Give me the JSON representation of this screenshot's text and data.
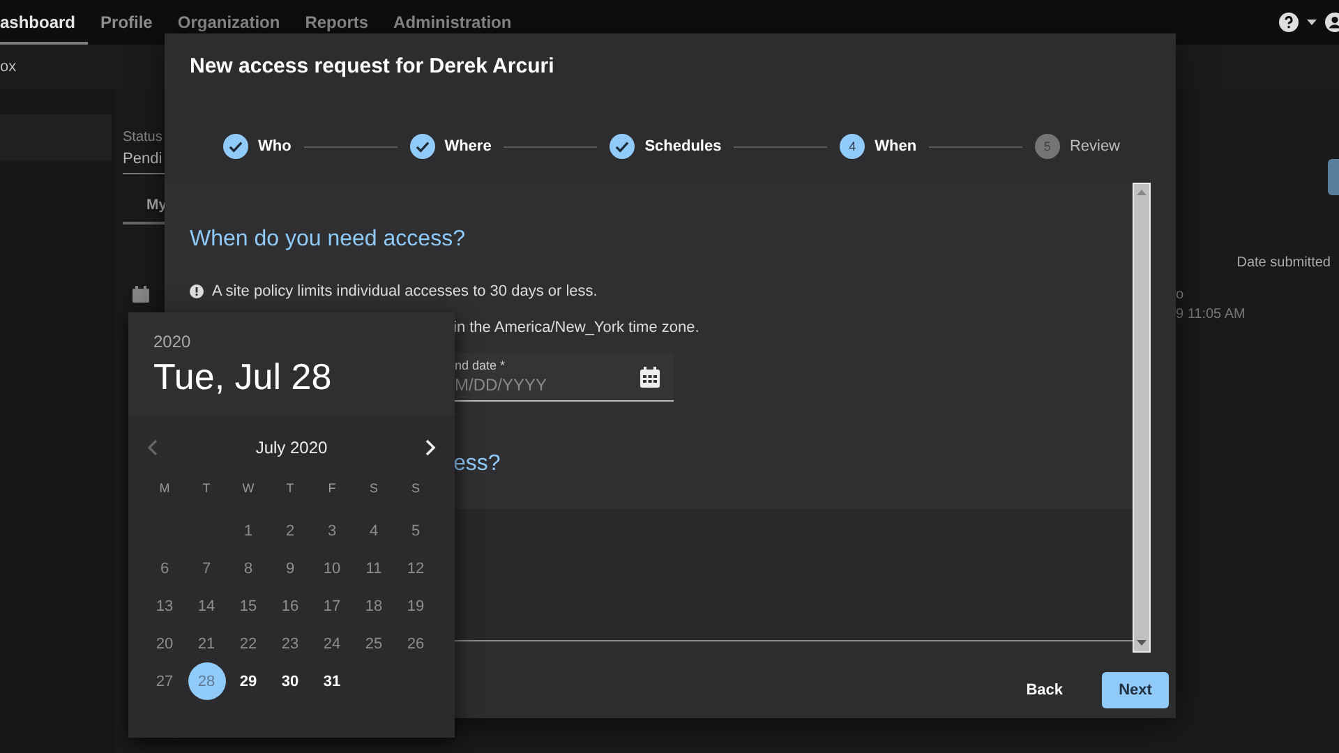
{
  "top_nav": {
    "tabs": [
      {
        "label": "ashboard",
        "selected": true
      },
      {
        "label": "Profile",
        "selected": false
      },
      {
        "label": "Organization",
        "selected": false
      },
      {
        "label": "Reports",
        "selected": false
      },
      {
        "label": "Administration",
        "selected": false
      }
    ]
  },
  "sub_bar": {
    "title": "ox"
  },
  "background": {
    "status_label": "Status",
    "status_value": "Pendi",
    "tab": {
      "label": "My",
      "selected": true
    },
    "column_header": "Date submitted",
    "cell_fragment": "o",
    "cell_time": "9 11:05 AM"
  },
  "dialog": {
    "title": "New access request for Derek Arcuri",
    "steps": [
      {
        "label": "Who",
        "done": true
      },
      {
        "label": "Where",
        "done": true
      },
      {
        "label": "Schedules",
        "done": true
      },
      {
        "number": "4",
        "label": "When",
        "done": false,
        "current": true
      },
      {
        "number": "5",
        "label": "Review",
        "done": false,
        "current": false
      }
    ],
    "heading": "When do you need access?",
    "notice": "A site policy limits individual accesses to 30 days or less.",
    "timezone_note": "in the America/New_York time zone.",
    "end_date": {
      "label": "nd date *",
      "placeholder": "M/DD/YYYY"
    },
    "second_heading": "ess?",
    "buttons": [
      {
        "label": "Back",
        "kind": "text"
      },
      {
        "label": "Next",
        "kind": "primary"
      }
    ]
  },
  "date_picker": {
    "year": "2020",
    "date": "Tue, Jul 28",
    "month": "July 2020",
    "prev_disabled": true,
    "next_disabled": false,
    "weekdays": [
      "M",
      "T",
      "W",
      "T",
      "F",
      "S",
      "S"
    ],
    "days": [
      {
        "kind": "blank"
      },
      {
        "kind": "blank"
      },
      {
        "kind": "day",
        "label": "1",
        "disabled": true,
        "selected": false
      },
      {
        "kind": "day",
        "label": "2",
        "disabled": true,
        "selected": false
      },
      {
        "kind": "day",
        "label": "3",
        "disabled": true,
        "selected": false
      },
      {
        "kind": "day",
        "label": "4",
        "disabled": true,
        "selected": false
      },
      {
        "kind": "day",
        "label": "5",
        "disabled": true,
        "selected": false
      },
      {
        "kind": "day",
        "label": "6",
        "disabled": true,
        "selected": false
      },
      {
        "kind": "day",
        "label": "7",
        "disabled": true,
        "selected": false
      },
      {
        "kind": "day",
        "label": "8",
        "disabled": true,
        "selected": false
      },
      {
        "kind": "day",
        "label": "9",
        "disabled": true,
        "selected": false
      },
      {
        "kind": "day",
        "label": "10",
        "disabled": true,
        "selected": false
      },
      {
        "kind": "day",
        "label": "11",
        "disabled": true,
        "selected": false
      },
      {
        "kind": "day",
        "label": "12",
        "disabled": true,
        "selected": false
      },
      {
        "kind": "day",
        "label": "13",
        "disabled": true,
        "selected": false
      },
      {
        "kind": "day",
        "label": "14",
        "disabled": true,
        "selected": false
      },
      {
        "kind": "day",
        "label": "15",
        "disabled": true,
        "selected": false
      },
      {
        "kind": "day",
        "label": "16",
        "disabled": true,
        "selected": false
      },
      {
        "kind": "day",
        "label": "17",
        "disabled": true,
        "selected": false
      },
      {
        "kind": "day",
        "label": "18",
        "disabled": true,
        "selected": false
      },
      {
        "kind": "day",
        "label": "19",
        "disabled": true,
        "selected": false
      },
      {
        "kind": "day",
        "label": "20",
        "disabled": true,
        "selected": false
      },
      {
        "kind": "day",
        "label": "21",
        "disabled": true,
        "selected": false
      },
      {
        "kind": "day",
        "label": "22",
        "disabled": true,
        "selected": false
      },
      {
        "kind": "day",
        "label": "23",
        "disabled": true,
        "selected": false
      },
      {
        "kind": "day",
        "label": "24",
        "disabled": true,
        "selected": false
      },
      {
        "kind": "day",
        "label": "25",
        "disabled": true,
        "selected": false
      },
      {
        "kind": "day",
        "label": "26",
        "disabled": true,
        "selected": false
      },
      {
        "kind": "day",
        "label": "27",
        "disabled": true,
        "selected": false
      },
      {
        "kind": "day",
        "label": "28",
        "disabled": false,
        "selected": true
      },
      {
        "kind": "day",
        "label": "29",
        "disabled": false,
        "selected": false
      },
      {
        "kind": "day",
        "label": "30",
        "disabled": false,
        "selected": false
      },
      {
        "kind": "day",
        "label": "31",
        "disabled": false,
        "selected": false
      }
    ]
  }
}
